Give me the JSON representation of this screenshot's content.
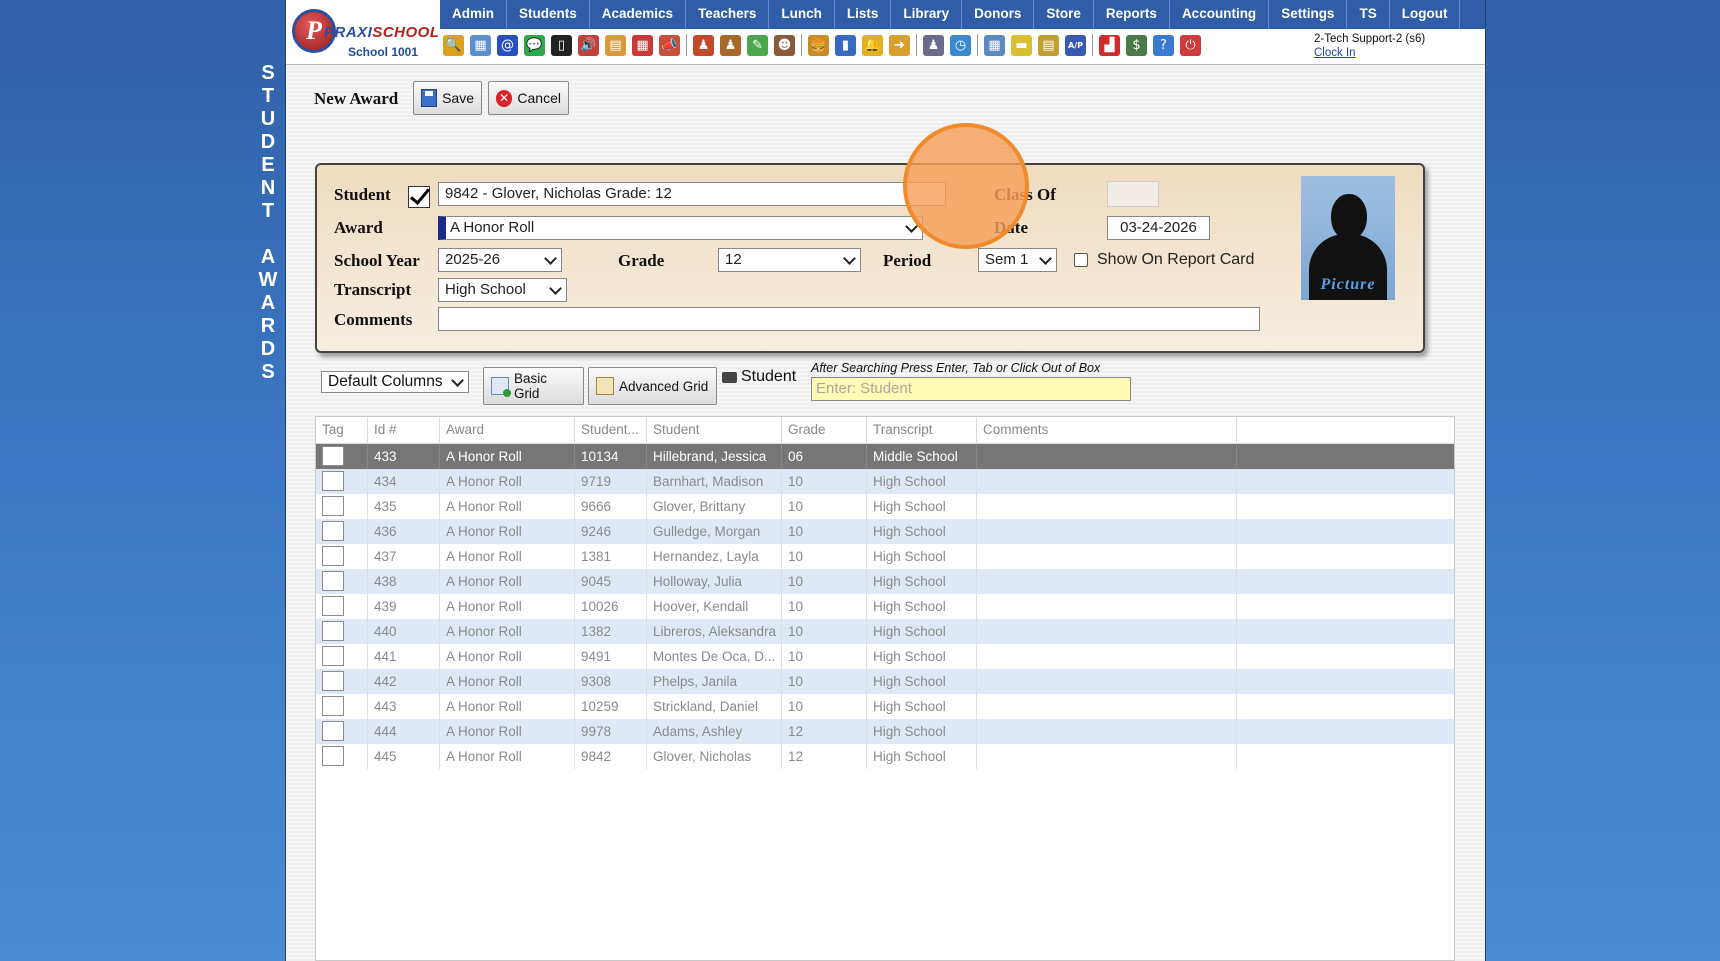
{
  "side_title": [
    "S",
    "T",
    "U",
    "D",
    "E",
    "N",
    "T",
    "",
    "A",
    "W",
    "A",
    "R",
    "D",
    "S"
  ],
  "logo": {
    "brand_a": "PRAXI",
    "brand_b": "SCHOOL",
    "school": "School 1001"
  },
  "menu": [
    "Admin",
    "Students",
    "Academics",
    "Teachers",
    "Lunch",
    "Lists",
    "Library",
    "Donors",
    "Store",
    "Reports",
    "Accounting",
    "Settings",
    "TS",
    "Logout"
  ],
  "toolbar_icons": [
    {
      "name": "search-icon",
      "color": "#d9a21a",
      "glyph": "🔍"
    },
    {
      "name": "table-icon",
      "color": "#5b8fd0",
      "glyph": "▦"
    },
    {
      "name": "email-icon",
      "color": "#2a4fc0",
      "glyph": "@"
    },
    {
      "name": "chat-icon",
      "color": "#2ea84a",
      "glyph": "💬"
    },
    {
      "name": "phone-icon",
      "color": "#222222",
      "glyph": "▯"
    },
    {
      "name": "speaker-icon",
      "color": "#c2423a",
      "glyph": "🔊"
    },
    {
      "name": "report-icon",
      "color": "#d99a3a",
      "glyph": "▤"
    },
    {
      "name": "calendar-icon",
      "color": "#c83a3a",
      "glyph": "▦"
    },
    {
      "name": "megaphone-icon",
      "color": "#c8503a",
      "glyph": "📣"
    },
    {
      "name": "sep"
    },
    {
      "name": "student-add-icon",
      "color": "#c04a2a",
      "glyph": "♟"
    },
    {
      "name": "student-icon",
      "color": "#a86a2a",
      "glyph": "♟"
    },
    {
      "name": "grade-icon",
      "color": "#4aa84a",
      "glyph": "✎"
    },
    {
      "name": "group-icon",
      "color": "#8a5a3a",
      "glyph": "☻"
    },
    {
      "name": "sep"
    },
    {
      "name": "lunch-icon",
      "color": "#c88a2a",
      "glyph": "🍔"
    },
    {
      "name": "book-icon",
      "color": "#3a6ac0",
      "glyph": "▮"
    },
    {
      "name": "bell-icon",
      "color": "#e0b020",
      "glyph": "🔔"
    },
    {
      "name": "export-icon",
      "color": "#d8a030",
      "glyph": "➜"
    },
    {
      "name": "sep"
    },
    {
      "name": "teacher-icon",
      "color": "#6a6a8a",
      "glyph": "♟"
    },
    {
      "name": "clock-icon",
      "color": "#3a8ad0",
      "glyph": "◷"
    },
    {
      "name": "sep"
    },
    {
      "name": "spreadsheet-icon",
      "color": "#5a8ac0",
      "glyph": "▦"
    },
    {
      "name": "card-icon",
      "color": "#d8c030",
      "glyph": "▬"
    },
    {
      "name": "printer-icon",
      "color": "#c0a030",
      "glyph": "▤"
    },
    {
      "name": "accounts-payable-icon",
      "color": "#3a5ab0",
      "glyph": "A/P"
    },
    {
      "name": "sep"
    },
    {
      "name": "pdf-icon",
      "color": "#d02a2a",
      "glyph": "▟"
    },
    {
      "name": "money-icon",
      "color": "#4a7a4a",
      "glyph": "$"
    },
    {
      "name": "help-icon",
      "color": "#3a7ad0",
      "glyph": "?"
    },
    {
      "name": "power-icon",
      "color": "#d03a3a",
      "glyph": "⏻"
    }
  ],
  "user": {
    "name": "2-Tech Support-2 (s6)",
    "clock_in": "Clock In"
  },
  "page": {
    "title": "New Award",
    "save": "Save",
    "cancel": "Cancel"
  },
  "form": {
    "student_label": "Student",
    "student_value": "9842 - Glover, Nicholas Grade: 12",
    "class_of_label": "Class Of",
    "class_of_value": "",
    "award_label": "Award",
    "award_value": "A Honor Roll",
    "date_label": "Date",
    "date_value": "03-24-2026",
    "school_year_label": "School Year",
    "school_year_value": "2025-26",
    "grade_label": "Grade",
    "grade_value": "12",
    "period_label": "Period",
    "period_value": "Sem 1",
    "report_card_label": "Show On Report Card",
    "transcript_label": "Transcript",
    "transcript_value": "High School",
    "comments_label": "Comments",
    "comments_value": "",
    "picture_caption": "Picture"
  },
  "grid_controls": {
    "columns_select": "Default Columns",
    "basic_grid": "Basic Grid",
    "advanced_grid": "Advanced Grid",
    "student_label": "Student",
    "search_hint": "After Searching Press Enter, Tab or Click Out of Box",
    "search_placeholder": "Enter: Student"
  },
  "grid": {
    "columns": [
      "Tag",
      "Id #",
      "Award",
      "Student...",
      "Student",
      "Grade",
      "Transcript",
      "Comments"
    ],
    "rows": [
      {
        "id": "433",
        "award": "A Honor Roll",
        "sid": "10134",
        "student": "Hillebrand, Jessica",
        "grade": "06",
        "transcript": "Middle School",
        "comments": "",
        "selected": true
      },
      {
        "id": "434",
        "award": "A Honor Roll",
        "sid": "9719",
        "student": "Barnhart, Madison",
        "grade": "10",
        "transcript": "High School",
        "comments": ""
      },
      {
        "id": "435",
        "award": "A Honor Roll",
        "sid": "9666",
        "student": "Glover, Brittany",
        "grade": "10",
        "transcript": "High School",
        "comments": ""
      },
      {
        "id": "436",
        "award": "A Honor Roll",
        "sid": "9246",
        "student": "Gulledge, Morgan",
        "grade": "10",
        "transcript": "High School",
        "comments": ""
      },
      {
        "id": "437",
        "award": "A Honor Roll",
        "sid": "1381",
        "student": "Hernandez, Layla",
        "grade": "10",
        "transcript": "High School",
        "comments": ""
      },
      {
        "id": "438",
        "award": "A Honor Roll",
        "sid": "9045",
        "student": "Holloway, Julia",
        "grade": "10",
        "transcript": "High School",
        "comments": ""
      },
      {
        "id": "439",
        "award": "A Honor Roll",
        "sid": "10026",
        "student": "Hoover, Kendall",
        "grade": "10",
        "transcript": "High School",
        "comments": ""
      },
      {
        "id": "440",
        "award": "A Honor Roll",
        "sid": "1382",
        "student": "Libreros, Aleksandra",
        "grade": "10",
        "transcript": "High School",
        "comments": ""
      },
      {
        "id": "441",
        "award": "A Honor Roll",
        "sid": "9491",
        "student": "Montes De Oca, D...",
        "grade": "10",
        "transcript": "High School",
        "comments": ""
      },
      {
        "id": "442",
        "award": "A Honor Roll",
        "sid": "9308",
        "student": "Phelps, Janila",
        "grade": "10",
        "transcript": "High School",
        "comments": ""
      },
      {
        "id": "443",
        "award": "A Honor Roll",
        "sid": "10259",
        "student": "Strickland, Daniel",
        "grade": "10",
        "transcript": "High School",
        "comments": ""
      },
      {
        "id": "444",
        "award": "A Honor Roll",
        "sid": "9978",
        "student": "Adams, Ashley",
        "grade": "12",
        "transcript": "High School",
        "comments": ""
      },
      {
        "id": "445",
        "award": "A Honor Roll",
        "sid": "9842",
        "student": "Glover, Nicholas",
        "grade": "12",
        "transcript": "High School",
        "comments": ""
      }
    ]
  }
}
